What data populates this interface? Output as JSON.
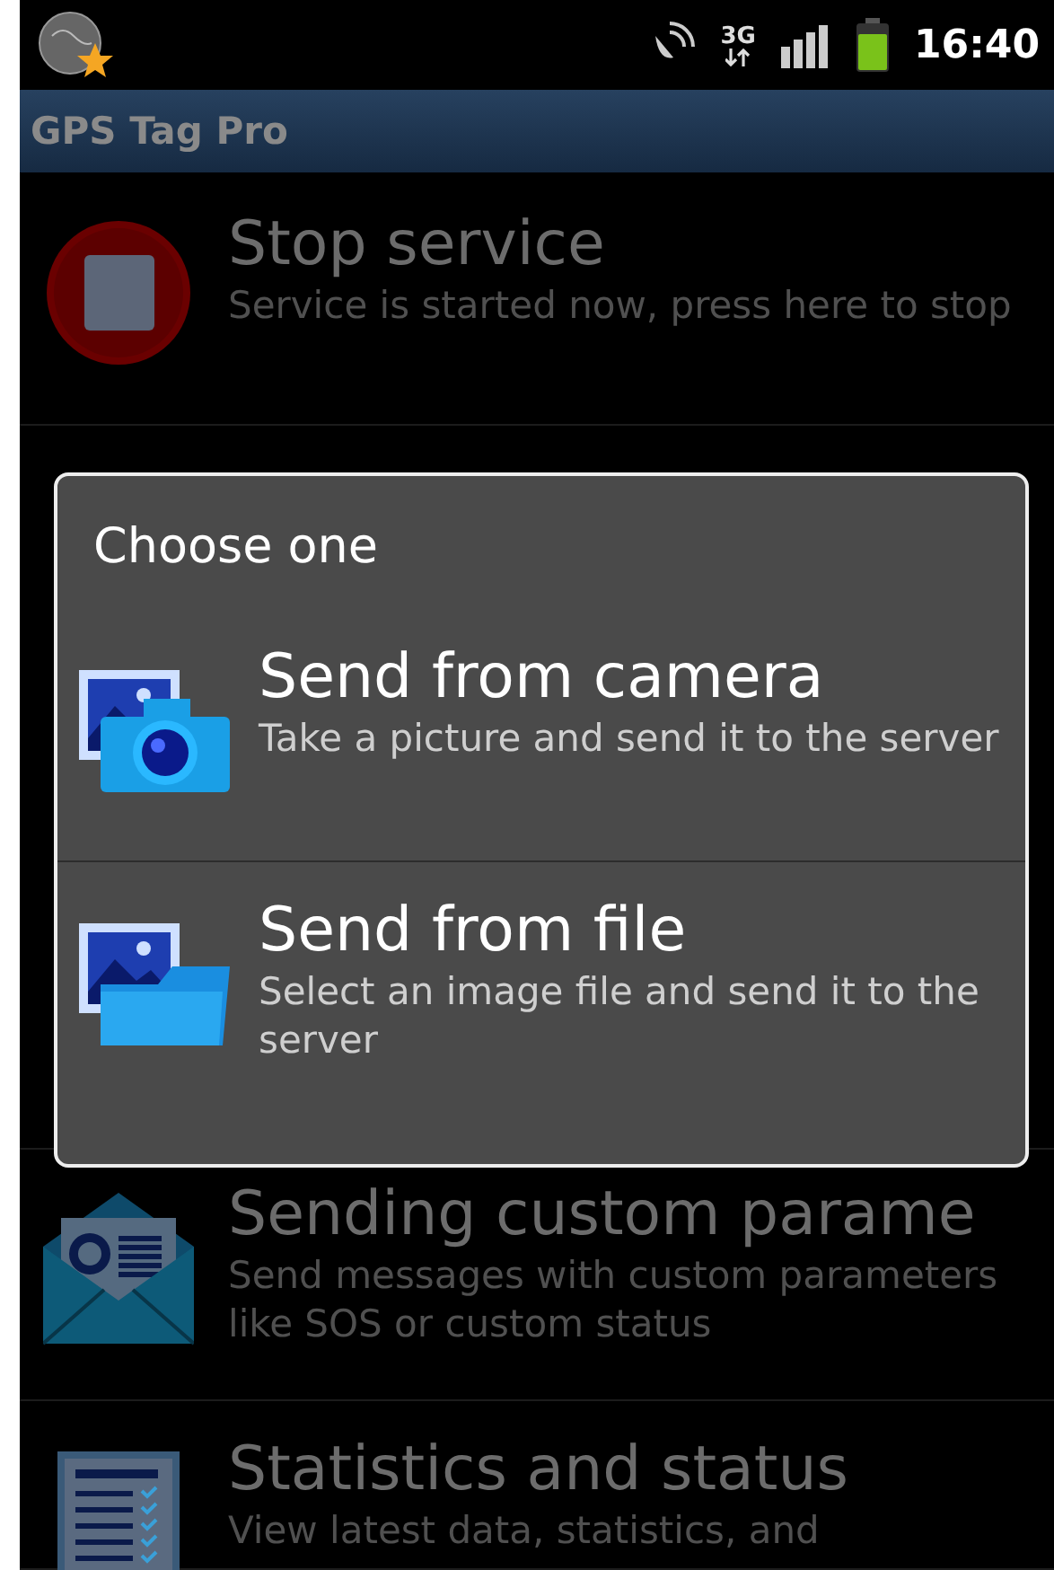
{
  "status_bar": {
    "network": "3G",
    "time": "16:40"
  },
  "app_bar": {
    "title": "GPS Tag Pro"
  },
  "list": [
    {
      "kind": "stop",
      "title": "Stop service",
      "subtitle": "Service is started now, press here to stop"
    },
    {
      "kind": "covered"
    },
    {
      "kind": "message",
      "title": "Sending custom parame",
      "subtitle": "Send messages with custom parameters like SOS or custom status"
    },
    {
      "kind": "stats",
      "title": "Statistics and status",
      "subtitle": "View latest data, statistics, and"
    }
  ],
  "dialog": {
    "title": "Choose one",
    "options": [
      {
        "kind": "camera",
        "title": "Send from camera",
        "subtitle": "Take a picture and send it to the server"
      },
      {
        "kind": "file",
        "title": "Send from file",
        "subtitle": "Select an image file and send it to the server"
      }
    ]
  }
}
